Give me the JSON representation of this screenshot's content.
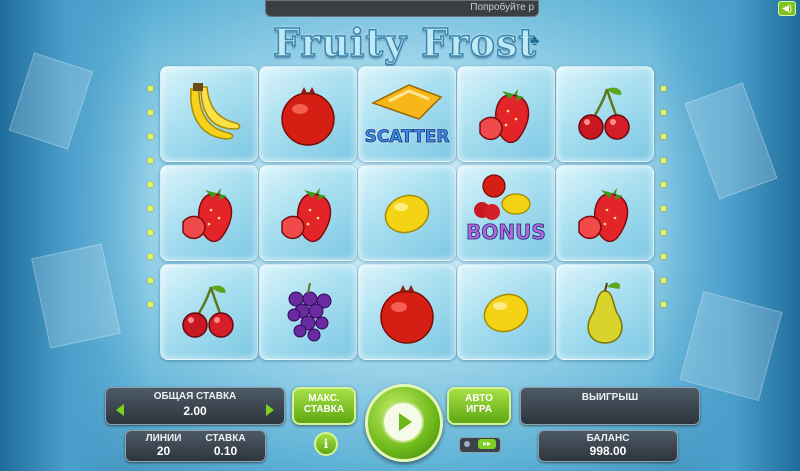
{
  "top_bar": {
    "text": "Попробуйте р",
    "sound_icon": "speaker-icon"
  },
  "logo": {
    "text": "Fruity Frost"
  },
  "reels": [
    [
      "banana",
      "pomegranate",
      "strawberry",
      "cherry"
    ],
    [
      "strawberry",
      "strawberry",
      "lemon",
      "strawberry"
    ],
    [
      "cherry",
      "grapes",
      "pomegranate",
      "lemon",
      "pear"
    ]
  ],
  "grid": [
    [
      {
        "symbol": "banana"
      },
      {
        "symbol": "pomegranate"
      },
      {
        "symbol": "scatter",
        "label": "SCATTER"
      },
      {
        "symbol": "strawberry"
      },
      {
        "symbol": "cherry"
      }
    ],
    [
      {
        "symbol": "strawberry"
      },
      {
        "symbol": "strawberry"
      },
      {
        "symbol": "lemon"
      },
      {
        "symbol": "bonus",
        "label": "BONUS"
      },
      {
        "symbol": "strawberry"
      }
    ],
    [
      {
        "symbol": "cherry"
      },
      {
        "symbol": "grapes"
      },
      {
        "symbol": "pomegranate"
      },
      {
        "symbol": "lemon"
      },
      {
        "symbol": "pear"
      }
    ]
  ],
  "controls": {
    "total_bet": {
      "label": "ОБЩАЯ СТАВКА",
      "value": "2.00"
    },
    "lines": {
      "label": "ЛИНИИ",
      "value": "20"
    },
    "bet": {
      "label": "СТАВКА",
      "value": "0.10"
    },
    "max_bet": {
      "line1": "МАКС.",
      "line2": "СТАВКА"
    },
    "autoplay": {
      "line1": "АВТО",
      "line2": "ИГРА"
    },
    "win": {
      "label": "ВЫИГРЫШ",
      "value": ""
    },
    "balance": {
      "label": "БАЛАНС",
      "value": "998.00"
    },
    "info": "i",
    "speed": "▸▸"
  },
  "colors": {
    "accent_green": "#7ed021",
    "panel_dark": "#2d353d",
    "ice_light": "#dbf4fb"
  }
}
